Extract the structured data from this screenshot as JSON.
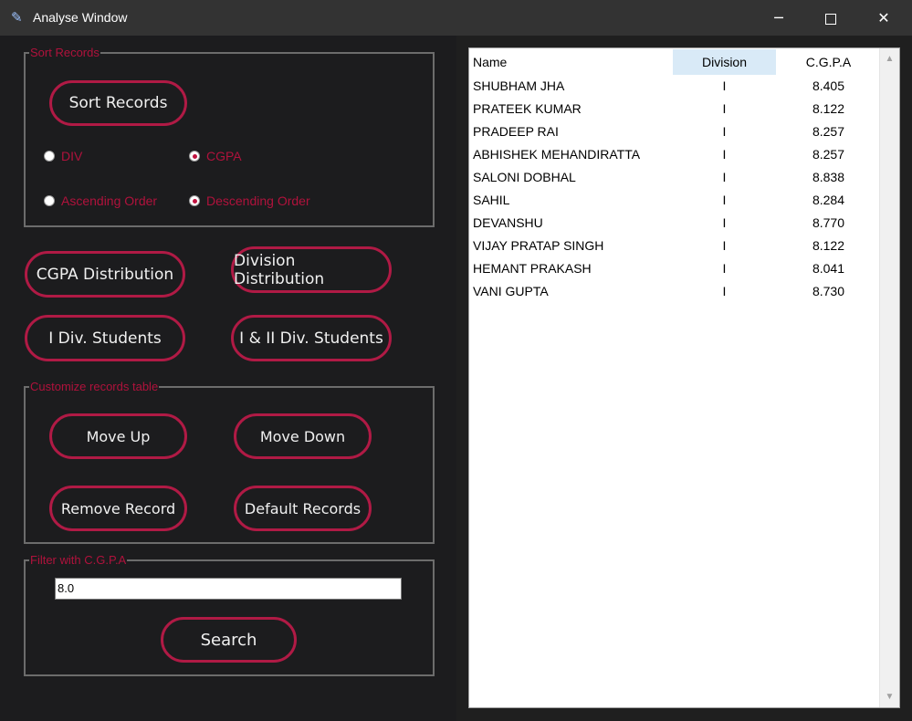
{
  "window": {
    "title": "Analyse Window",
    "icon": "feather-icon",
    "controls": {
      "minimize": "─",
      "close": "✕"
    }
  },
  "colors": {
    "accent": "#b01a45",
    "label": "#b0123c",
    "panel_bg": "#1c1c1e",
    "titlebar_bg": "#333333"
  },
  "sort_group": {
    "legend": "Sort Records",
    "sort_button": "Sort Records",
    "radios": {
      "div": {
        "label": "DIV",
        "checked": false
      },
      "cgpa": {
        "label": "CGPA",
        "checked": true
      },
      "ascending": {
        "label": "Ascending Order",
        "checked": false
      },
      "descending": {
        "label": "Descending Order",
        "checked": true
      }
    }
  },
  "actions": {
    "cgpa_distribution": "CGPA Distribution",
    "division_distribution": "Division Distribution",
    "first_div_students": "I Div. Students",
    "first_second_div_students": "I & II Div. Students"
  },
  "customize_group": {
    "legend": "Customize records table",
    "move_up": "Move Up",
    "move_down": "Move Down",
    "remove_record": "Remove Record",
    "default_records": "Default Records"
  },
  "filter_group": {
    "legend": "Filter with C.G.P.A",
    "input_value": "8.0",
    "search_button": "Search"
  },
  "table": {
    "columns": [
      "Name",
      "Division",
      "C.G.P.A"
    ],
    "rows": [
      [
        "SHUBHAM JHA",
        "I",
        "8.405"
      ],
      [
        "PRATEEK KUMAR",
        "I",
        "8.122"
      ],
      [
        "PRADEEP RAI",
        "I",
        "8.257"
      ],
      [
        "ABHISHEK MEHANDIRATTA",
        "I",
        "8.257"
      ],
      [
        "SALONI DOBHAL",
        "I",
        "8.838"
      ],
      [
        "SAHIL",
        "I",
        "8.284"
      ],
      [
        "DEVANSHU",
        "I",
        "8.770"
      ],
      [
        "VIJAY PRATAP SINGH",
        "I",
        "8.122"
      ],
      [
        "HEMANT PRAKASH",
        "I",
        "8.041"
      ],
      [
        "VANI GUPTA",
        "I",
        "8.730"
      ]
    ]
  }
}
